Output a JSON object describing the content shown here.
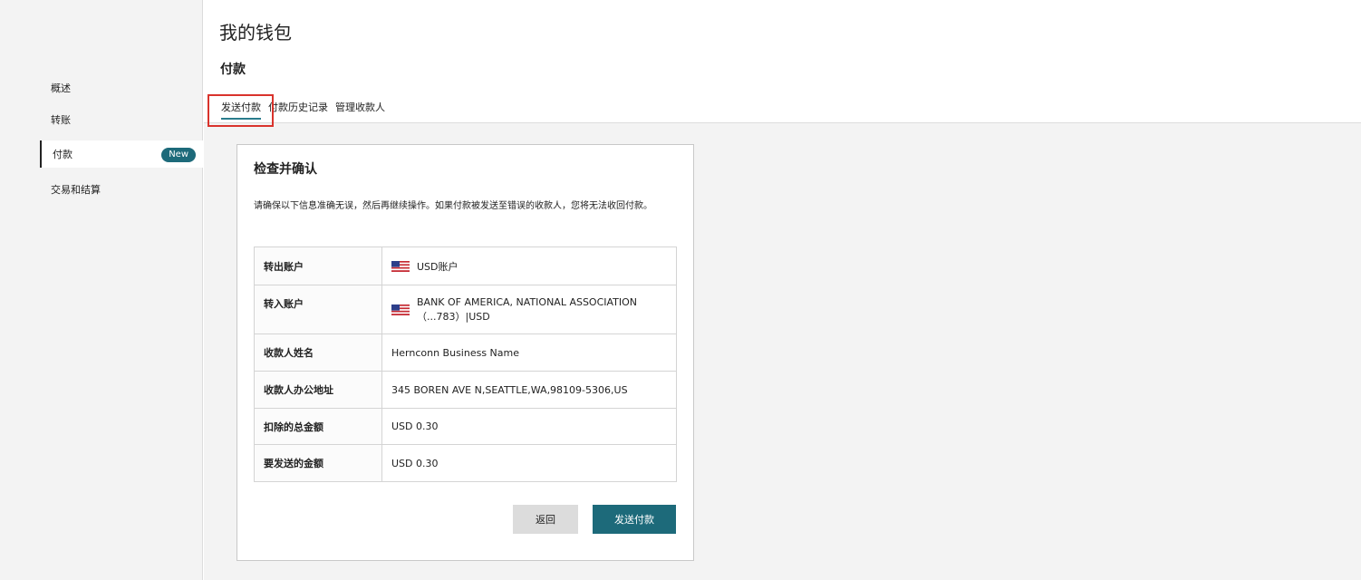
{
  "sidebar": {
    "items": [
      {
        "label": "概述"
      },
      {
        "label": "转账"
      },
      {
        "label": "付款",
        "badge": "New"
      },
      {
        "label": "交易和结算"
      }
    ]
  },
  "header": {
    "title": "我的钱包",
    "section": "付款",
    "tabs": [
      {
        "label": "发送付款",
        "active": true
      },
      {
        "label": "付款历史记录"
      },
      {
        "label": "管理收款人"
      }
    ]
  },
  "card": {
    "title": "检查并确认",
    "description": "请确保以下信息准确无误，然后再继续操作。如果付款被发送至错误的收款人，您将无法收回付款。",
    "rows": [
      {
        "label": "转出账户",
        "value": "USD账户",
        "flag": "us-flag-icon"
      },
      {
        "label": "转入账户",
        "value_line1": "BANK OF AMERICA, NATIONAL ASSOCIATION",
        "value_line2": "（...783）|USD",
        "flag": "us-flag-icon"
      },
      {
        "label": "收款人姓名",
        "value": "Hernconn Business Name"
      },
      {
        "label": "收款人办公地址",
        "value": "345 BOREN AVE N,SEATTLE,WA,98109-5306,US"
      },
      {
        "label": "扣除的总金额",
        "value": "USD 0.30"
      },
      {
        "label": "要发送的金额",
        "value": "USD 0.30"
      }
    ],
    "back_label": "返回",
    "send_label": "发送付款"
  },
  "colors": {
    "accent": "#1d6a7a",
    "highlight": "#d9332c"
  }
}
